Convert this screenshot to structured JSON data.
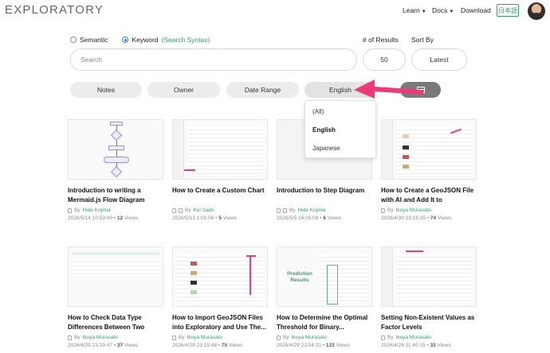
{
  "app": {
    "title": "EXPLORATORY"
  },
  "nav": {
    "learn": "Learn",
    "docs": "Docs",
    "download": "Download",
    "language_button": "日本語"
  },
  "search": {
    "mode_semantic": "Semantic",
    "mode_keyword": "Keyword",
    "syntax_link": "(Search Syntax)",
    "placeholder": "Search",
    "results_label": "# of Results",
    "results_value": "50",
    "sort_label": "Sort By",
    "sort_value": "Latest"
  },
  "filters": {
    "notes": "Notes",
    "owner": "Owner",
    "date_range": "Date Range",
    "language": "English"
  },
  "language_dropdown": {
    "options": [
      "(All)",
      "English",
      "Japanese"
    ],
    "selected": "English"
  },
  "colors": {
    "accent_green": "#2ea36a",
    "radio_blue": "#2b7de9",
    "arrow_pink": "#ee3a7a"
  },
  "cards": [
    {
      "title": "Introduction to writing a Mermaid.js Flow Diagram",
      "by": "By",
      "author": "Hide Kojima",
      "date": "2026/5/14 10:53:09",
      "views_count": "12",
      "views_label": "Views"
    },
    {
      "title": "How to Create a Custom Chart",
      "by": "By",
      "author": "Kei Saito",
      "date": "2026/5/13 1:01:06",
      "views_count": "5",
      "views_label": "Views"
    },
    {
      "title": "Introduction to Step Diagram",
      "by": "By",
      "author": "Hide Kojima",
      "date": "2026/5/5 16:06:08",
      "views_count": "6",
      "views_label": "Views"
    },
    {
      "title": "How to Create a GeoJSON File with AI and Add It to Exploratory",
      "by": "By",
      "author": "Ikuya Murasato",
      "date": "2026/4/30 23:16:35",
      "views_count": "74",
      "views_label": "Views"
    },
    {
      "title": "How to Check Data Type Differences Between Two Data...",
      "by": "By",
      "author": "Ikuya Murasato",
      "date": "2026/4/29 23:29:47",
      "views_count": "37",
      "views_label": "Views"
    },
    {
      "title": "How to Import GeoJSON Files into Exploratory and Use The...",
      "by": "By",
      "author": "Ikuya Murasato",
      "date": "2026/4/29 23:15:48",
      "views_count": "75",
      "views_label": "Views"
    },
    {
      "title": "How to Determine the Optimal Threshold for Binary...",
      "by": "By",
      "author": "Ikuya Murasato",
      "date": "2026/4/29 23:04:31",
      "views_count": "133",
      "views_label": "Views",
      "thumb_text": "Prediction Results"
    },
    {
      "title": "Setting Non-Existent Values as Factor Levels",
      "by": "By",
      "author": "Ikuya Murasato",
      "date": "2026/4/28 11:40:19",
      "views_count": "33",
      "views_label": "Views"
    }
  ]
}
